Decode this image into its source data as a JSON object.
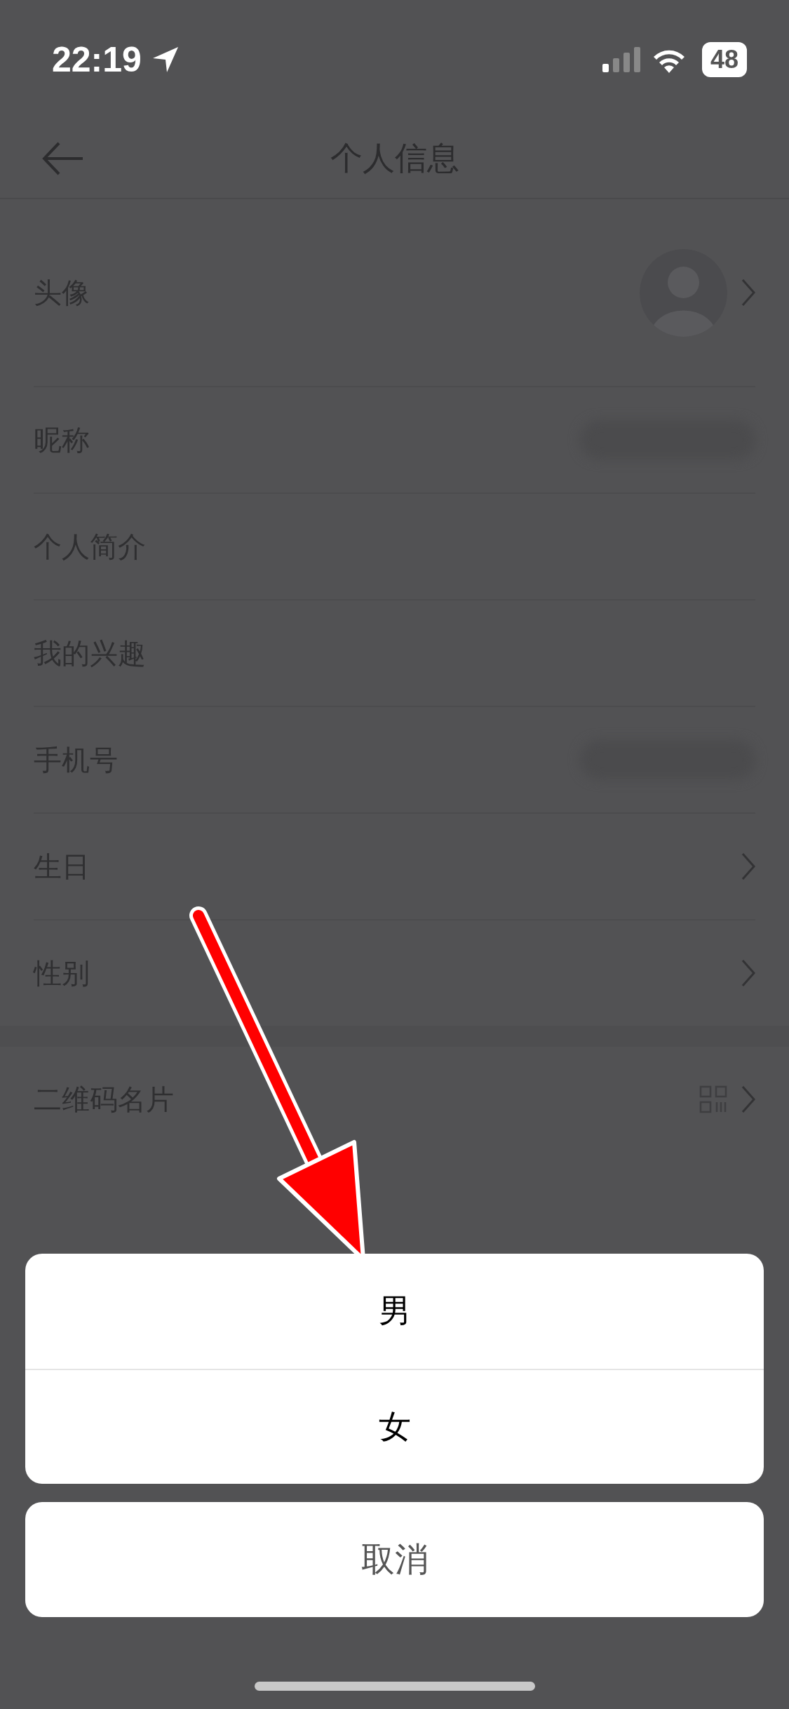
{
  "status_bar": {
    "time": "22:19",
    "battery": "48"
  },
  "nav": {
    "title": "个人信息"
  },
  "sections": [
    {
      "rows": [
        {
          "label": "头像",
          "kind": "avatar"
        },
        {
          "label": "昵称",
          "kind": "hidden"
        },
        {
          "label": "个人简介",
          "kind": "plain"
        },
        {
          "label": "我的兴趣",
          "kind": "plain"
        },
        {
          "label": "手机号",
          "kind": "hidden"
        },
        {
          "label": "生日",
          "kind": "link"
        },
        {
          "label": "性别",
          "kind": "link"
        }
      ]
    },
    {
      "rows": [
        {
          "label": "二维码名片",
          "kind": "qr"
        }
      ]
    }
  ],
  "action_sheet": {
    "options": [
      "男",
      "女"
    ],
    "cancel": "取消"
  }
}
